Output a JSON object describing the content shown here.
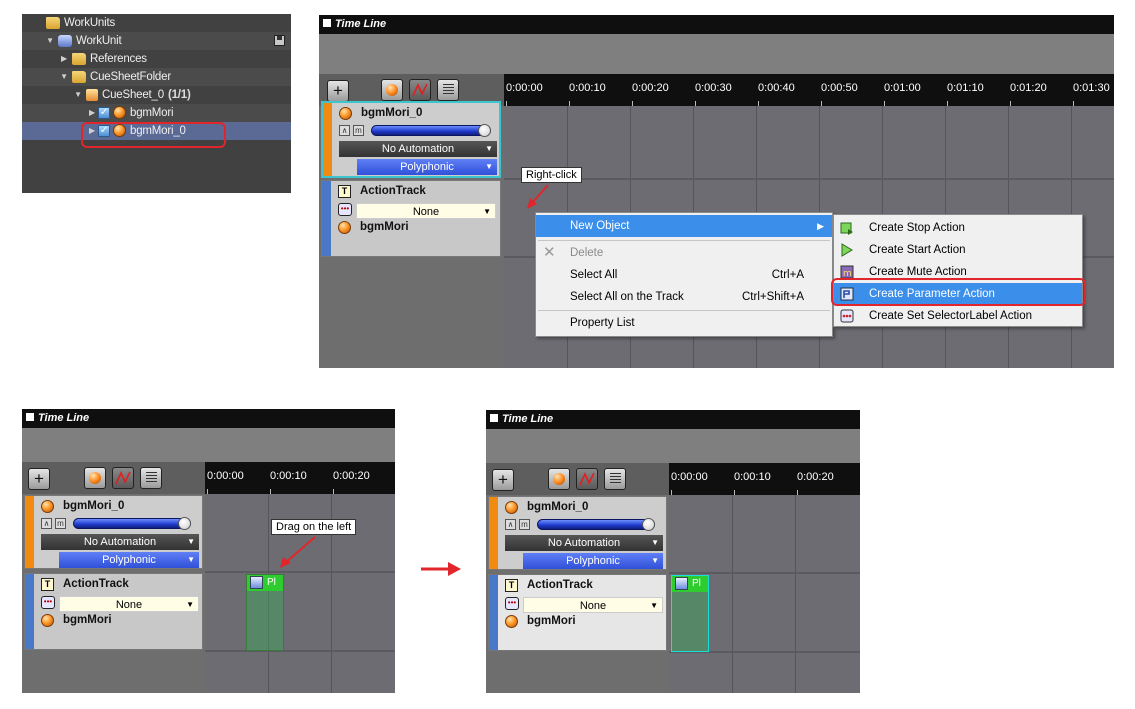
{
  "tree": {
    "rows": [
      {
        "label": "WorkUnits",
        "indent": 0,
        "icon": "folder-icon"
      },
      {
        "label": "WorkUnit",
        "indent": 1,
        "icon": "workunit-icon"
      },
      {
        "label": "References",
        "indent": 2,
        "icon": "folder-icon"
      },
      {
        "label": "CueSheetFolder",
        "indent": 2,
        "icon": "folder-icon"
      },
      {
        "label": "CueSheet_0",
        "indent": 3,
        "icon": "cuesheet-icon",
        "count": "(1/1)"
      },
      {
        "label": "bgmMori",
        "indent": 4,
        "icon": "cue-icon"
      },
      {
        "label": "bgmMori_0",
        "indent": 4,
        "icon": "cue-icon"
      }
    ]
  },
  "timeline": {
    "title": "Time Line",
    "ticks_main": [
      "0:00:00",
      "0:00:10",
      "0:00:20",
      "0:00:30",
      "0:00:40",
      "0:00:50",
      "0:01:00",
      "0:01:10",
      "0:01:20",
      "0:01:30"
    ],
    "ticks_small": [
      "0:00:00",
      "0:00:10",
      "0:00:20"
    ],
    "cue_track": {
      "name": "bgmMori_0",
      "automation": "No Automation",
      "mode": "Polyphonic"
    },
    "action_track": {
      "name": "ActionTrack",
      "selector": "None",
      "sub": "bgmMori"
    },
    "action_block_label": "Pl"
  },
  "context_menu": {
    "items": [
      {
        "label": "New Object",
        "shortcut": "",
        "state": "highlighted"
      },
      {
        "label": "Delete",
        "shortcut": "",
        "state": "disabled"
      },
      {
        "label": "Select All",
        "shortcut": "Ctrl+A",
        "state": "normal"
      },
      {
        "label": "Select All on the Track",
        "shortcut": "Ctrl+Shift+A",
        "state": "normal"
      },
      {
        "label": "Property List",
        "shortcut": "",
        "state": "normal"
      }
    ],
    "submenu": [
      {
        "label": "Create Stop Action",
        "icon": "stop-action-icon"
      },
      {
        "label": "Create Start Action",
        "icon": "start-action-icon"
      },
      {
        "label": "Create Mute Action",
        "icon": "mute-action-icon"
      },
      {
        "label": "Create Parameter Action",
        "icon": "parameter-action-icon"
      },
      {
        "label": "Create Set SelectorLabel Action",
        "icon": "selector-label-action-icon"
      }
    ]
  },
  "annotations": {
    "right_click": "Right-click",
    "drag_left": "Drag on the left"
  },
  "colors": {
    "highlight_box": "#e0262b",
    "menu_highlight": "#3b8ee9",
    "cue_stripe": "#f08a10",
    "action_stripe": "#4a78c8"
  }
}
